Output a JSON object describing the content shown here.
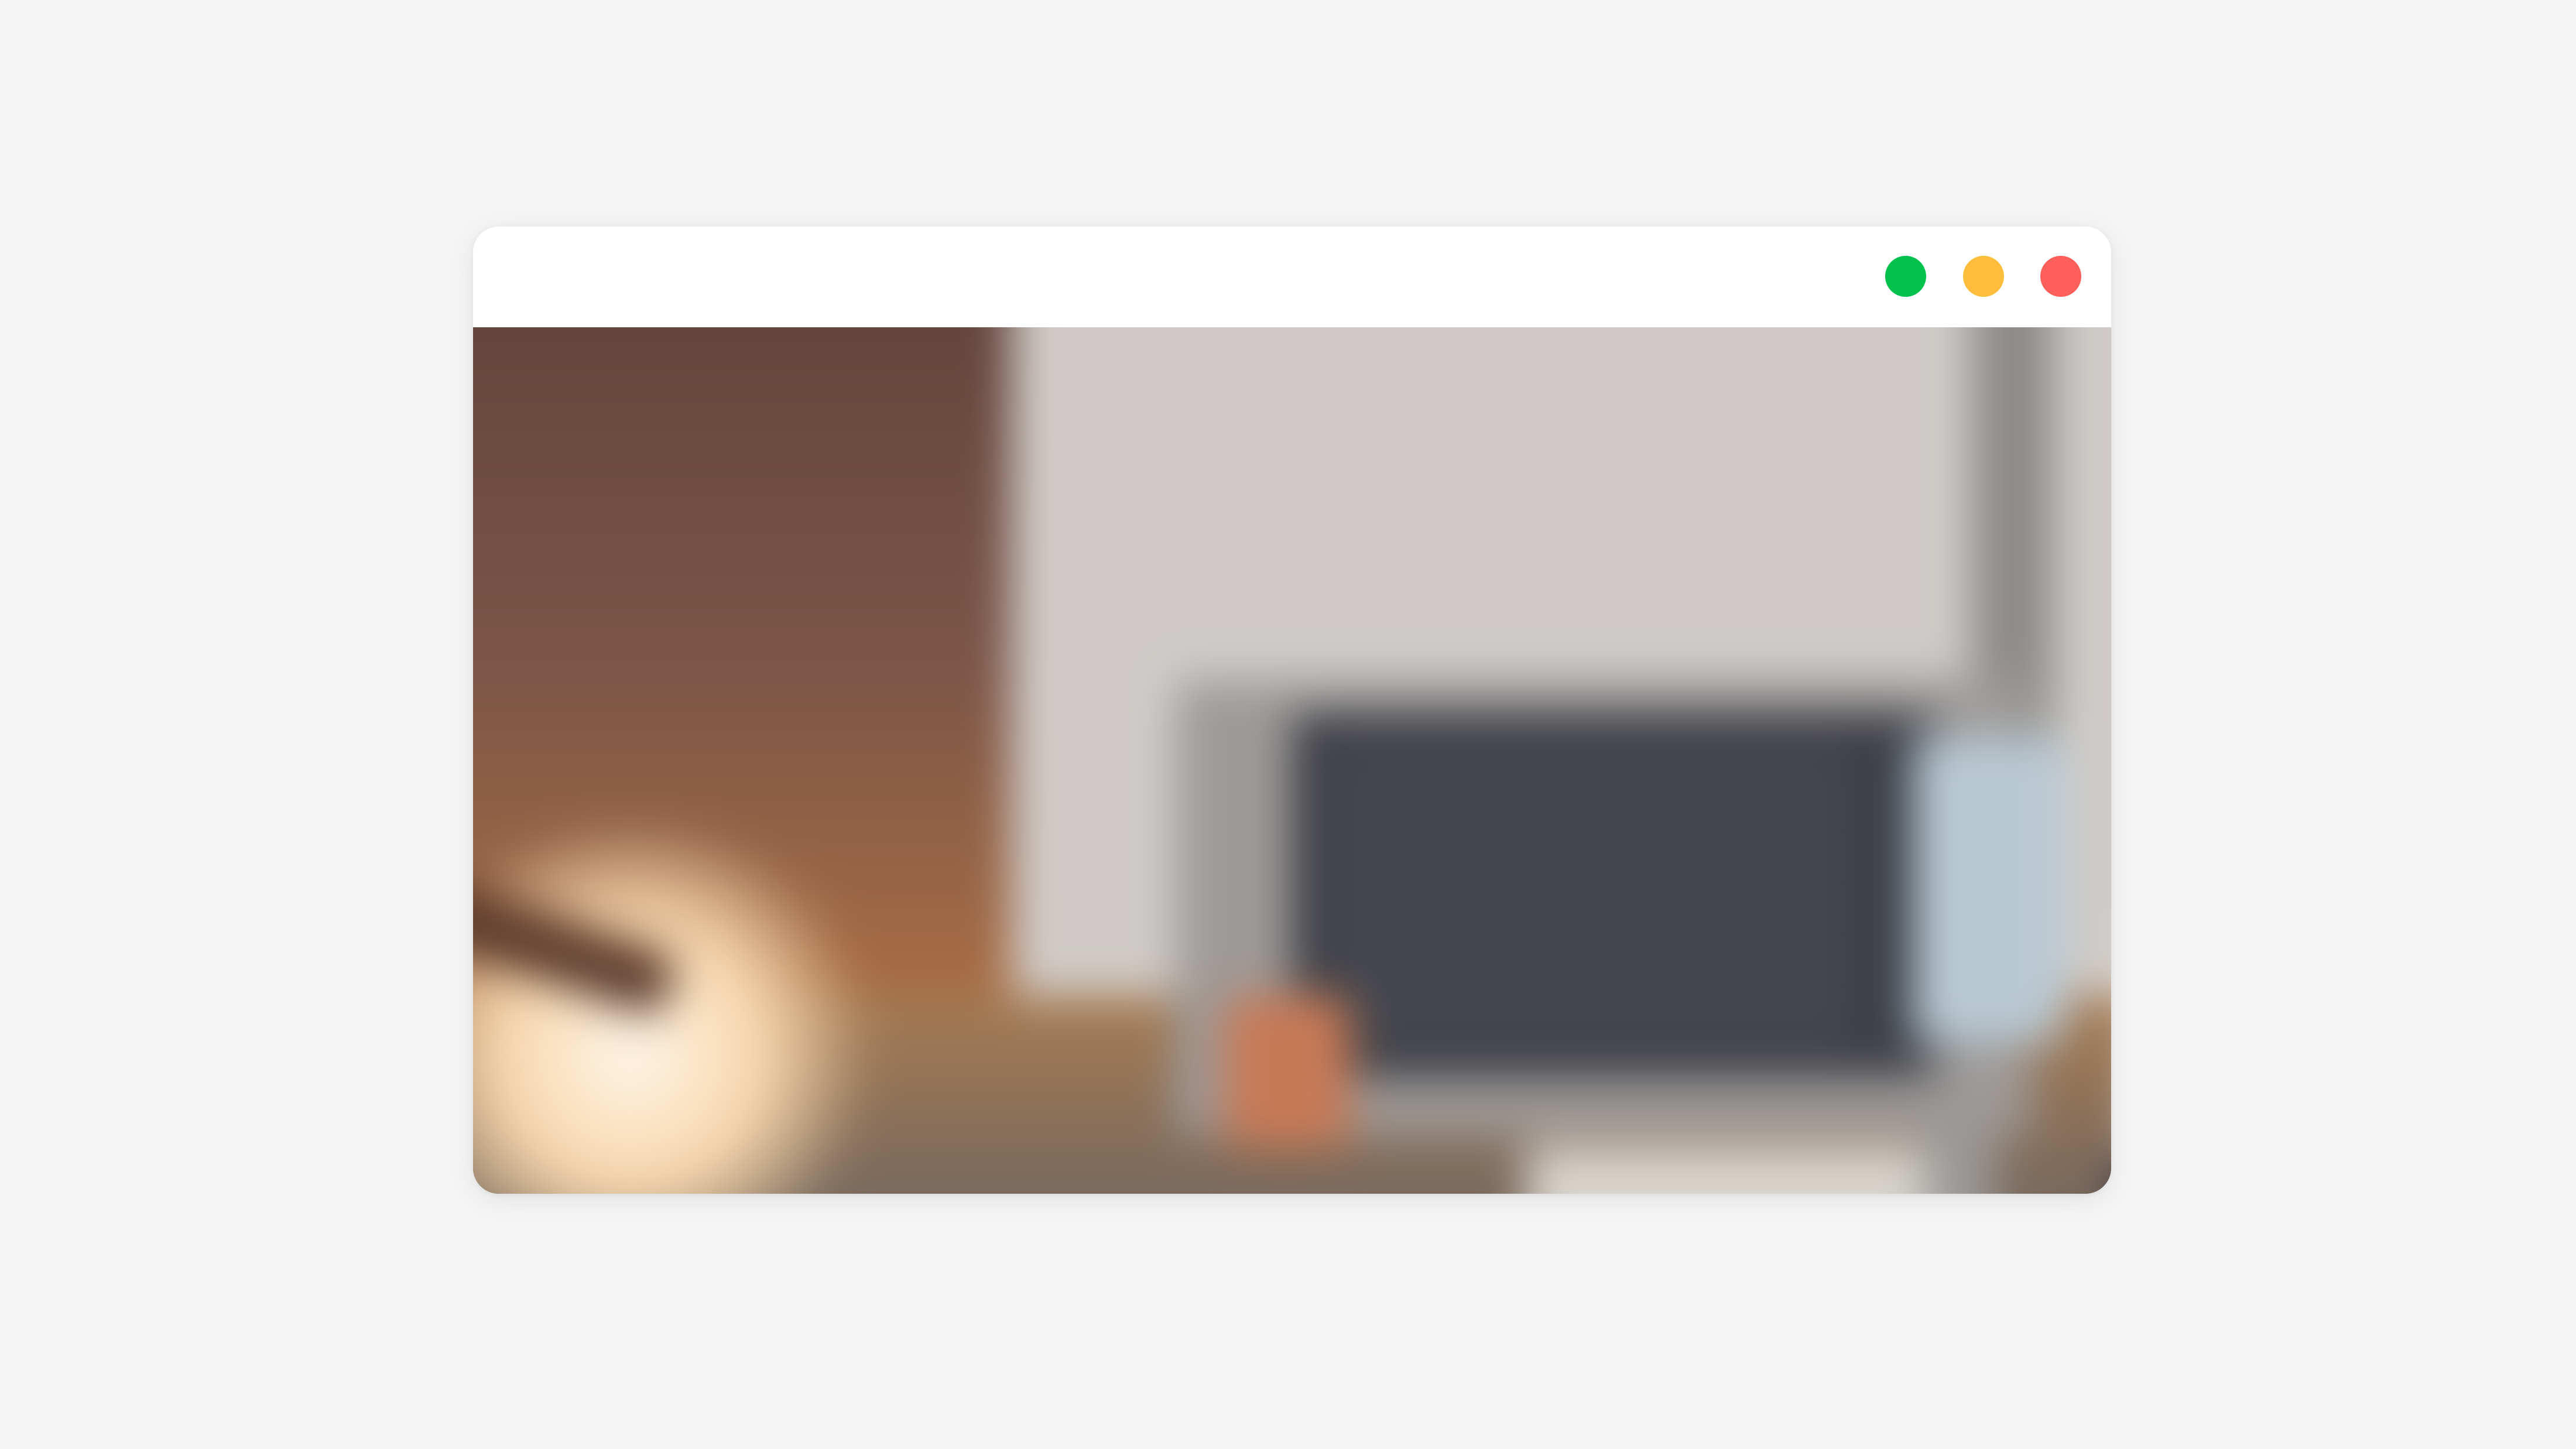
{
  "window": {
    "controls": {
      "maximize_color": "#00c24c",
      "minimize_color": "#ffbd3c",
      "close_color": "#ff5f5a"
    }
  },
  "content": {
    "image_subject": "blurred-desk-workspace-photo"
  }
}
